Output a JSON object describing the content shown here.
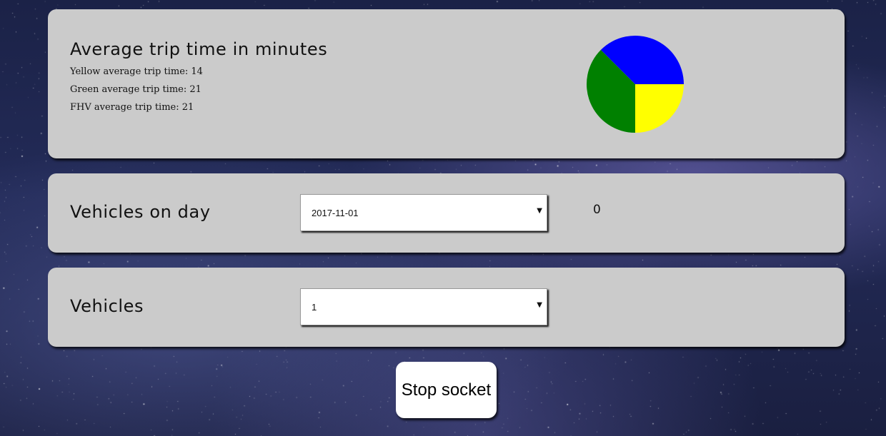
{
  "colors": {
    "card_background": "#cbcbcb",
    "yellow": "#ffff00",
    "green": "#008000",
    "blue": "#0000ff"
  },
  "trip_card": {
    "title": "Average trip time in minutes",
    "lines": [
      "Yellow average trip time: 14",
      "Green average trip time: 21",
      "FHV average trip time: 21"
    ]
  },
  "chart_data": {
    "type": "pie",
    "categories": [
      "Yellow",
      "Green",
      "FHV"
    ],
    "values": [
      14,
      21,
      21
    ],
    "colors": [
      "#ffff00",
      "#008000",
      "#0000ff"
    ],
    "title": ""
  },
  "day_card": {
    "title": "Vehicles on day",
    "select_value": "2017-11-01",
    "count": "0"
  },
  "vehicles_card": {
    "title": "Vehicles",
    "select_value": "1"
  },
  "stop_button": {
    "label": "Stop socket"
  }
}
